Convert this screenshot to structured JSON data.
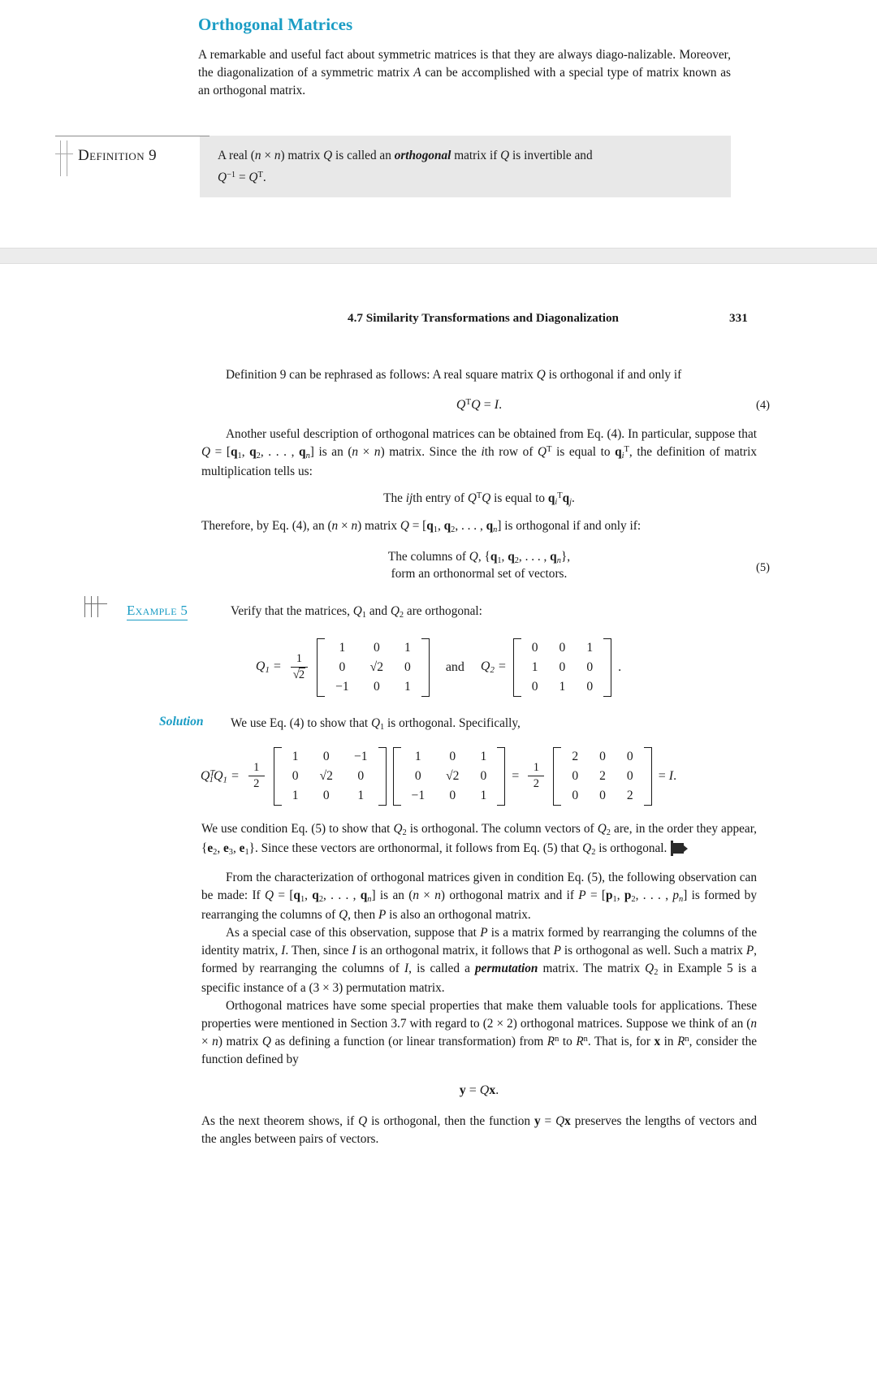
{
  "top_section": {
    "heading": "Orthogonal Matrices",
    "paragraph_part1": "A remarkable and useful fact about symmetric matrices is that they are always diago-nalizable. Moreover, the diagonalization of a symmetric matrix ",
    "paragraph_italic_A": "A",
    "paragraph_part2": " can be accomplished with a special type of matrix known as an orthogonal matrix.",
    "definition": {
      "label": "Definition",
      "number": "9",
      "text_pre": "A real (",
      "text_n1": "n",
      "text_times": " × ",
      "text_n2": "n",
      "text_mid": ") matrix ",
      "text_Q1": "Q",
      "text_mid2": " is called an ",
      "text_bold": "orthogonal",
      "text_mid3": " matrix if ",
      "text_Q2": "Q",
      "text_end": " is invertible and",
      "formula_Q": "Q",
      "formula_sup1": "−1",
      "formula_eq": " = ",
      "formula_Q2": "Q",
      "formula_sup2": "T",
      "formula_period": "."
    }
  },
  "running_head": {
    "title": "4.7  Similarity Transformations and Diagonalization",
    "page_number": "331"
  },
  "body": {
    "para1_a": "Definition 9 can be rephrased as follows:  A real square matrix ",
    "para1_Q": "Q",
    "para1_b": " is orthogonal if and only if",
    "eq4": {
      "lhs_Q": "Q",
      "lhs_sup": "T",
      "lhs_Q2": "Q",
      "rel": " = ",
      "rhs": "I",
      "period": ".",
      "number": "(4)"
    },
    "para2_a": "Another useful description of orthogonal matrices can be obtained from Eq. (4).  In particular, suppose that ",
    "para2_Q": "Q",
    "para2_eq": " = [",
    "para2_q1": "q",
    "para2_q1s": "1",
    "para2_c1": ", ",
    "para2_q2": "q",
    "para2_q2s": "2",
    "para2_c2": ", . . . , ",
    "para2_qn": "q",
    "para2_qns": "n",
    "para2_b": "] is an (",
    "para2_n1": "n",
    "para2_times": " × ",
    "para2_n2": "n",
    "para2_c": ") matrix.  Since the ",
    "para2_i": "i",
    "para2_d": "th row of ",
    "para2_QT": "Q",
    "para2_QTs": "T",
    "para2_e": " is equal to ",
    "para2_qi": "q",
    "para2_qisub": "i",
    "para2_qisup": "T",
    "para2_f": ", the definition of matrix multiplication tells us:",
    "center1_a": "The ",
    "center1_i": "i",
    "center1_j": "j",
    "center1_b": "th entry of ",
    "center1_Q": "Q",
    "center1_Qs": "T",
    "center1_Q2": "Q",
    "center1_c": " is equal to ",
    "center1_qi": "q",
    "center1_qisub": "i",
    "center1_qisup": "T",
    "center1_qj": "q",
    "center1_qjsub": "j",
    "center1_end": ".",
    "para3_a": "Therefore, by Eq. (4), an (",
    "para3_n1": "n",
    "para3_times": " × ",
    "para3_n2": "n",
    "para3_b": ") matrix ",
    "para3_Q": "Q",
    "para3_eq": " = [",
    "para3_q1": "q",
    "para3_q1s": "1",
    "para3_c1": ", ",
    "para3_q2": "q",
    "para3_q2s": "2",
    "para3_c2": ", . . . , ",
    "para3_qn": "q",
    "para3_qns": "n",
    "para3_c": "] is orthogonal if and only if:",
    "eq5_line1_a": "The columns of ",
    "eq5_line1_Q": "Q",
    "eq5_line1_b": ", {",
    "eq5_line1_q1": "q",
    "eq5_line1_q1s": "1",
    "eq5_line1_c1": ", ",
    "eq5_line1_q2": "q",
    "eq5_line1_q2s": "2",
    "eq5_line1_c2": ", . . . , ",
    "eq5_line1_qn": "q",
    "eq5_line1_qns": "n",
    "eq5_line1_end": "},",
    "eq5_line2": "form an orthonormal set of vectors.",
    "eq5_number": "(5)"
  },
  "example": {
    "label": "Example 5",
    "text_a": "Verify that the matrices, ",
    "text_Q1": "Q",
    "text_Q1s": "1",
    "text_and": " and ",
    "text_Q2": "Q",
    "text_Q2s": "2",
    "text_b": " are orthogonal:",
    "Q1_label": "Q",
    "Q1_sub": "1",
    "Q1_eq": " = ",
    "Q1_scalar_num": "1",
    "Q1_scalar_den": "2",
    "Q1_matrix": [
      [
        "1",
        "0",
        "1"
      ],
      [
        "0",
        "√2",
        "0"
      ],
      [
        "−1",
        "0",
        "1"
      ]
    ],
    "conj": "and",
    "Q2_label": "Q",
    "Q2_sub": "2",
    "Q2_eq": " = ",
    "Q2_matrix": [
      [
        "0",
        "0",
        "1"
      ],
      [
        "1",
        "0",
        "0"
      ],
      [
        "0",
        "1",
        "0"
      ]
    ],
    "period": "."
  },
  "solution": {
    "label": "Solution",
    "text_a": "We use Eq. (4) to show that ",
    "text_Q1": "Q",
    "text_Q1s": "1",
    "text_b": " is orthogonal.  Specifically,",
    "lhs_Q": "Q",
    "lhs_sup": "T",
    "lhs_sub": "1",
    "lhs_Q2": "Q",
    "lhs_sub2": "1",
    "lhs_eq": " = ",
    "scalar1_num": "1",
    "scalar1_den": "2",
    "matrixA": [
      [
        "1",
        "0",
        "−1"
      ],
      [
        "0",
        "√2",
        "0"
      ],
      [
        "1",
        "0",
        "1"
      ]
    ],
    "matrixB": [
      [
        "1",
        "0",
        "1"
      ],
      [
        "0",
        "√2",
        "0"
      ],
      [
        "−1",
        "0",
        "1"
      ]
    ],
    "mid_eq": " = ",
    "scalar2_num": "1",
    "scalar2_den": "2",
    "matrixC": [
      [
        "2",
        "0",
        "0"
      ],
      [
        "0",
        "2",
        "0"
      ],
      [
        "0",
        "0",
        "2"
      ]
    ],
    "tail_eq": " = ",
    "tail_I": "I",
    "tail_period": ".",
    "para_a": "We use condition Eq. (5) to show that ",
    "para_Q2": "Q",
    "para_Q2s": "2",
    "para_b": " is orthogonal.  The column vectors of ",
    "para_Q2b": "Q",
    "para_Q2bs": "2",
    "para_c": " are, in the order they appear, {",
    "para_e2": "e",
    "para_e2s": "2",
    "para_c1": ", ",
    "para_e3": "e",
    "para_e3s": "3",
    "para_c2": ", ",
    "para_e1": "e",
    "para_e1s": "1",
    "para_d": "}.  Since these vectors are orthonormal, it follows from Eq. (5) that ",
    "para_Q2c": "Q",
    "para_Q2cs": "2",
    "para_e": " is orthogonal."
  },
  "closing": {
    "p1_a": "From the characterization of orthogonal matrices given in condition Eq. (5), the following observation can be made:  If ",
    "p1_Q": "Q",
    "p1_eq": " = [",
    "p1_q1": "q",
    "p1_q1s": "1",
    "p1_c1": ", ",
    "p1_q2": "q",
    "p1_q2s": "2",
    "p1_c2": ", . . . , ",
    "p1_qn": "q",
    "p1_qns": "n",
    "p1_b": "] is an (",
    "p1_n1": "n",
    "p1_times": " × ",
    "p1_n2": "n",
    "p1_c": ") orthogonal matrix and if ",
    "p1_P": "P",
    "p1_eq2": " = [",
    "p1_p1": "p",
    "p1_p1s": "1",
    "p1_c3": ", ",
    "p1_p2": "p",
    "p1_p2s": "2",
    "p1_c4": ", . . . , ",
    "p1_pn": "p",
    "p1_pns": "n",
    "p1_d": "] is formed by rearranging the columns of ",
    "p1_Q2": "Q",
    "p1_e": ", then ",
    "p1_P2": "P",
    "p1_f": " is also an orthogonal matrix.",
    "p2_a": "As a special case of this observation, suppose that ",
    "p2_P": "P",
    "p2_b": " is a matrix formed by rearranging the columns of the identity matrix, ",
    "p2_I": "I",
    "p2_c": ".  Then, since ",
    "p2_I2": "I",
    "p2_d": " is an orthogonal matrix, it follows that ",
    "p2_P2": "P",
    "p2_e": " is orthogonal as well.  Such a matrix ",
    "p2_P3": "P",
    "p2_f": ", formed by rearranging the columns of ",
    "p2_I3": "I",
    "p2_g": ", is called a ",
    "p2_bold": "permutation",
    "p2_h": " matrix.  The matrix ",
    "p2_Q2": "Q",
    "p2_Q2s": "2",
    "p2_i": " in Example 5 is a specific instance of a (3 × 3) permutation matrix.",
    "p3_a": "Orthogonal matrices have some special properties that make them valuable tools for applications.  These properties were mentioned in Section 3.7 with regard to (2 × 2) orthogonal matrices.  Suppose we think of an (",
    "p3_n1": "n",
    "p3_times": " × ",
    "p3_n2": "n",
    "p3_b": ") matrix ",
    "p3_Q": "Q",
    "p3_c": " as defining a function (or linear transformation) from ",
    "p3_R1": "R",
    "p3_R1s": "n",
    "p3_d": " to ",
    "p3_R2": "R",
    "p3_R2s": "n",
    "p3_e": ".  That is, for ",
    "p3_x": "x",
    "p3_f": " in ",
    "p3_R3": "R",
    "p3_R3s": "n",
    "p3_g": ", consider the function defined by",
    "eq_y": "y",
    "eq_rel": " = ",
    "eq_Q": "Q",
    "eq_x": "x",
    "eq_period": ".",
    "p4_a": "As the next theorem shows, if ",
    "p4_Q": "Q",
    "p4_b": " is orthogonal, then the function ",
    "p4_y": "y",
    "p4_eq": " = ",
    "p4_Q2": "Q",
    "p4_x": "x",
    "p4_c": " preserves the lengths of vectors and the angles between pairs of vectors."
  },
  "colors": {
    "accent_teal": "#1a9cc4",
    "definition_box_bg": "#e8e8e8",
    "band_bg": "#ececec",
    "text": "#161616"
  }
}
